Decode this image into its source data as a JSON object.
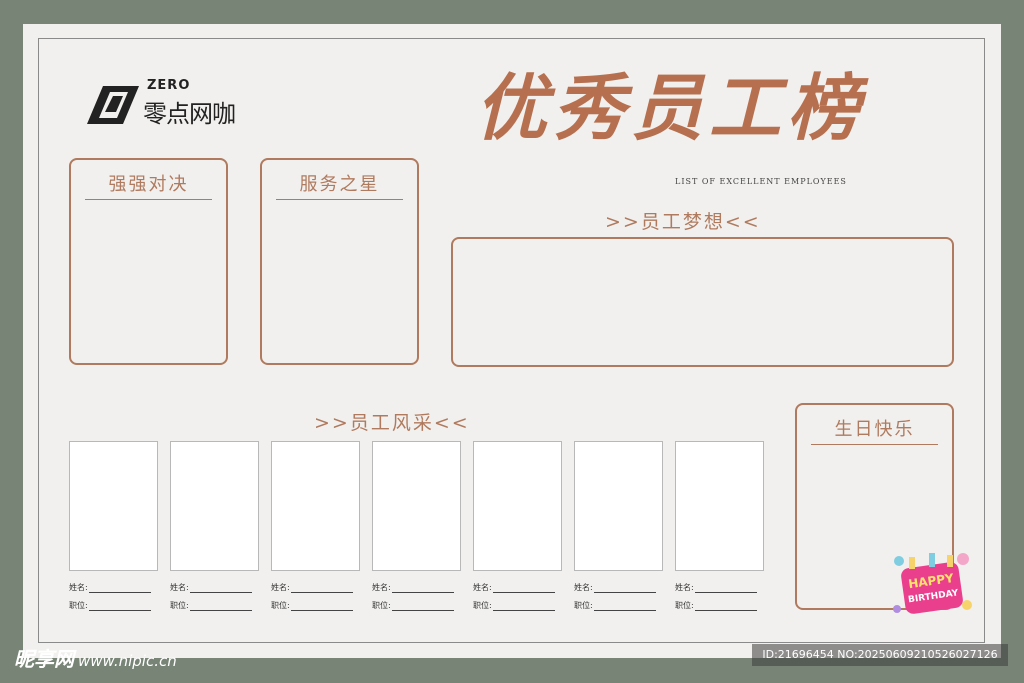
{
  "logo": {
    "brand_en": "ZERO",
    "brand_cn": "零点网咖",
    "icon": "zero-logo-icon"
  },
  "header": {
    "title": "优秀员工榜",
    "subtitle": "LIST OF EXCELLENT EMPLOYEES"
  },
  "panels": {
    "showdown": {
      "title": "强强对决"
    },
    "service_star": {
      "title": "服务之星"
    },
    "birthday": {
      "title": "生日快乐"
    }
  },
  "sections": {
    "dream": {
      "heading": ">>员工梦想<<"
    },
    "gallery": {
      "heading": ">>员工风采<<"
    }
  },
  "gallery": {
    "name_label": "姓名:",
    "position_label": "职位:",
    "count_cards": 7
  },
  "birthday_badge": {
    "line1": "HAPPY",
    "line2": "BIRTHDAY",
    "icon": "cake-icon"
  },
  "watermark": {
    "brand": "昵享网",
    "url": "www.nipic.cn",
    "id_text": "ID:21696454 NO:20250609210526027126"
  },
  "colors": {
    "accent": "#b07a5e",
    "title": "#b7704f",
    "board": "#f1f0ee",
    "background": "#778476"
  }
}
